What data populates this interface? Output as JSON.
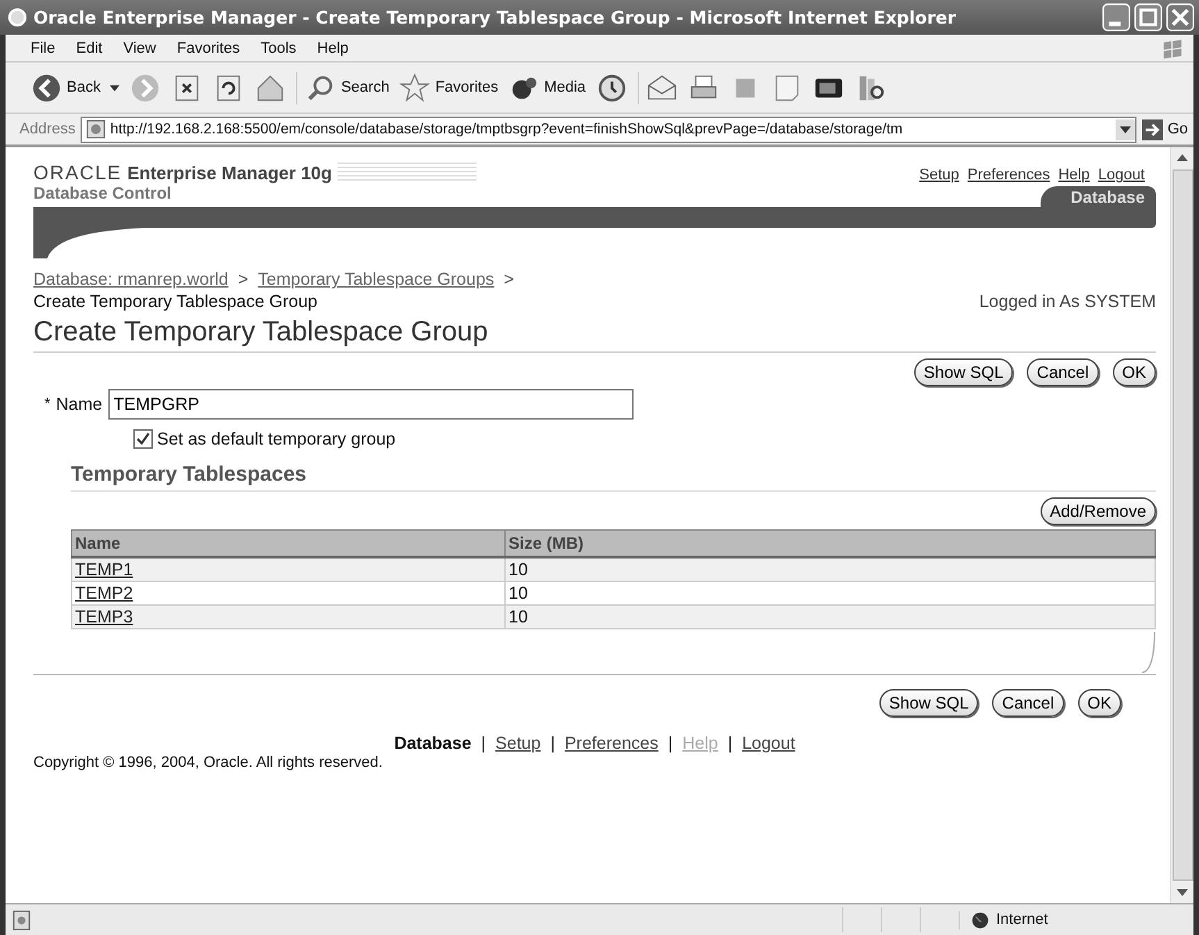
{
  "window": {
    "title": "Oracle Enterprise Manager - Create Temporary Tablespace Group - Microsoft Internet Explorer"
  },
  "menu": [
    "File",
    "Edit",
    "View",
    "Favorites",
    "Tools",
    "Help"
  ],
  "toolbar": [
    {
      "kind": "back",
      "label": "Back"
    },
    {
      "kind": "forward"
    },
    {
      "kind": "stop"
    },
    {
      "kind": "refresh"
    },
    {
      "kind": "home"
    },
    {
      "kind": "search",
      "label": "Search"
    },
    {
      "kind": "favorites",
      "label": "Favorites"
    },
    {
      "kind": "media",
      "label": "Media"
    },
    {
      "kind": "history"
    },
    {
      "kind": "mail"
    },
    {
      "kind": "print"
    },
    {
      "kind": "edit"
    },
    {
      "kind": "discuss"
    },
    {
      "kind": "messenger"
    },
    {
      "kind": "research"
    }
  ],
  "address": {
    "label": "Address",
    "value": "http://192.168.2.168:5500/em/console/database/storage/tmptbsgrp?event=finishShowSql&prevPage=/database/storage/tm",
    "go": "Go"
  },
  "header": {
    "logo": "ORACLE",
    "product": "Enterprise Manager 10g",
    "subtitle": "Database Control",
    "links": [
      "Setup",
      "Preferences",
      "Help",
      "Logout"
    ],
    "tab": "Database"
  },
  "breadcrumbs": [
    {
      "label": "Database: rmanrep.world",
      "separator": ">"
    },
    {
      "label": "Temporary Tablespace Groups",
      "separator": ">"
    }
  ],
  "breadcrumb_current": "Create Temporary Tablespace Group",
  "login": "Logged in As SYSTEM",
  "page_title": "Create Temporary Tablespace Group",
  "buttons": [
    "Show SQL",
    "Cancel",
    "OK"
  ],
  "name_field": {
    "required_mark": "*",
    "label": "Name",
    "value": "TEMPGRP"
  },
  "default_checkbox": {
    "label": "Set as default temporary group",
    "checked": true
  },
  "section_title": "Temporary Tablespaces",
  "add_remove": "Add/Remove",
  "table": {
    "columns": [
      "Name",
      "Size (MB)"
    ],
    "rows": [
      [
        "TEMP1",
        "10"
      ],
      [
        "TEMP2",
        "10"
      ],
      [
        "TEMP3",
        "10"
      ]
    ]
  },
  "bottom_buttons": [
    "Show SQL",
    "Cancel",
    "OK"
  ],
  "footer_links": [
    {
      "label": "Database",
      "kind": "current"
    },
    {
      "separator": "|",
      "label": "Setup",
      "kind": "link"
    },
    {
      "separator": "|",
      "label": "Preferences",
      "kind": "link"
    },
    {
      "separator": "|",
      "label": "Help",
      "kind": "disabled"
    },
    {
      "separator": "|",
      "label": "Logout",
      "kind": "link"
    }
  ],
  "copyright": "Copyright © 1996, 2004, Oracle. All rights reserved.",
  "status_bar": {
    "zone": "Internet"
  }
}
